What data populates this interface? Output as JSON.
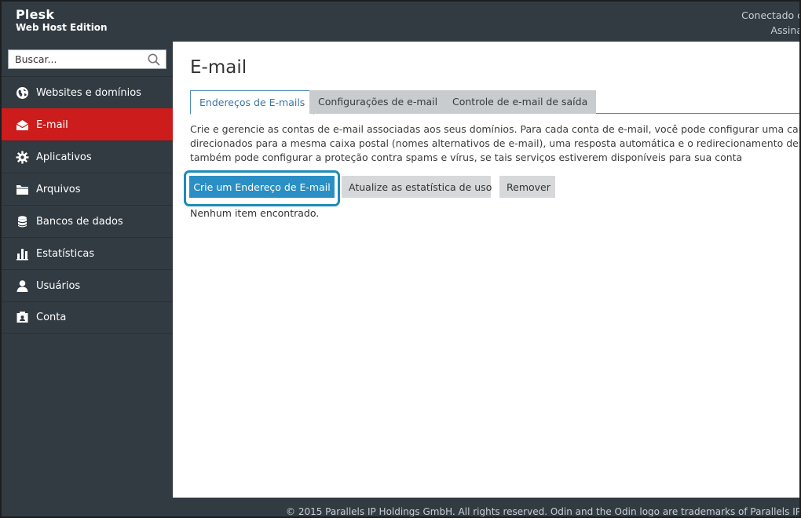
{
  "header": {
    "brand_name": "Plesk",
    "brand_edition": "Web Host Edition",
    "account_line1": "Conectado c",
    "account_line2": "Assina"
  },
  "sidebar": {
    "search_placeholder": "Buscar...",
    "items": [
      {
        "label": "Websites e domínios",
        "icon": "globe-icon",
        "active": false
      },
      {
        "label": "E-mail",
        "icon": "envelope-icon",
        "active": true
      },
      {
        "label": "Aplicativos",
        "icon": "gear-icon",
        "active": false
      },
      {
        "label": "Arquivos",
        "icon": "folder-icon",
        "active": false
      },
      {
        "label": "Bancos de dados",
        "icon": "database-icon",
        "active": false
      },
      {
        "label": "Estatísticas",
        "icon": "bar-chart-icon",
        "active": false
      },
      {
        "label": "Usuários",
        "icon": "user-icon",
        "active": false
      },
      {
        "label": "Conta",
        "icon": "account-icon",
        "active": false
      }
    ]
  },
  "main": {
    "title": "E-mail",
    "tabs": [
      {
        "label": "Endereços de E-mails",
        "active": true
      },
      {
        "label": "Configurações de e-mail",
        "active": false
      },
      {
        "label": "Controle de e-mail de saída",
        "active": false
      }
    ],
    "description": [
      "Crie e gerencie as contas de e-mail associadas aos seus domínios. Para cada conta de e-mail, você pode configurar uma caixa pos",
      "direcionados para a mesma caixa postal (nomes alternativos de e-mail), uma resposta automática e o redirecionamento de e-ma",
      "também pode configurar a proteção contra spams e vírus, se tais serviços estiverem disponíveis para sua conta"
    ],
    "buttons": {
      "create": "Crie um Endereço de E-mail",
      "update_stats": "Atualize as estatística de uso",
      "remove": "Remover"
    },
    "empty_message": "Nenhum item encontrado."
  },
  "footer": {
    "copyright": "© 2015 Parallels IP Holdings GmbH. All rights reserved. Odin and the Odin logo are trademarks of Parallels IP Holdings"
  },
  "colors": {
    "sidebar_bg": "#323b42",
    "active_nav": "#cc1c1c",
    "primary_button": "#2a8fc4",
    "highlight_border": "#1c8bb9",
    "tab_active_text": "#3b74a6"
  }
}
